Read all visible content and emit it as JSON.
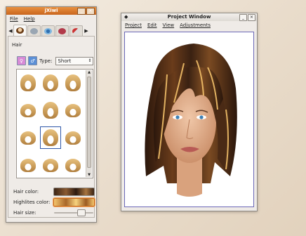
{
  "jxiwi": {
    "title": "jXiwi",
    "menu": [
      {
        "label": "File"
      },
      {
        "label": "Help"
      }
    ],
    "window_buttons": [
      "_",
      "×"
    ],
    "categories": [
      "hair-icon",
      "cap-icon",
      "eye-icon",
      "lips-icon",
      "brush-icon"
    ],
    "section": "Hair",
    "type_label": "Type:",
    "type_value": "Short",
    "hair_color_label": "Hair color:",
    "highlites_color_label": "Highlites color:",
    "hair_size_label": "Hair size:",
    "hair_size_level": 0.72
  },
  "project": {
    "title": "Project Window",
    "menu": [
      {
        "label": "Project"
      },
      {
        "label": "Edit"
      },
      {
        "label": "View"
      },
      {
        "label": "Adjustments"
      }
    ],
    "window_buttons": [
      "_",
      "×"
    ]
  },
  "colors": {
    "accent_orange": "#e08a3c",
    "hair_color": "#3b2415",
    "highlites_color": "#f3c46c",
    "canvas_border": "#6a67b6"
  }
}
